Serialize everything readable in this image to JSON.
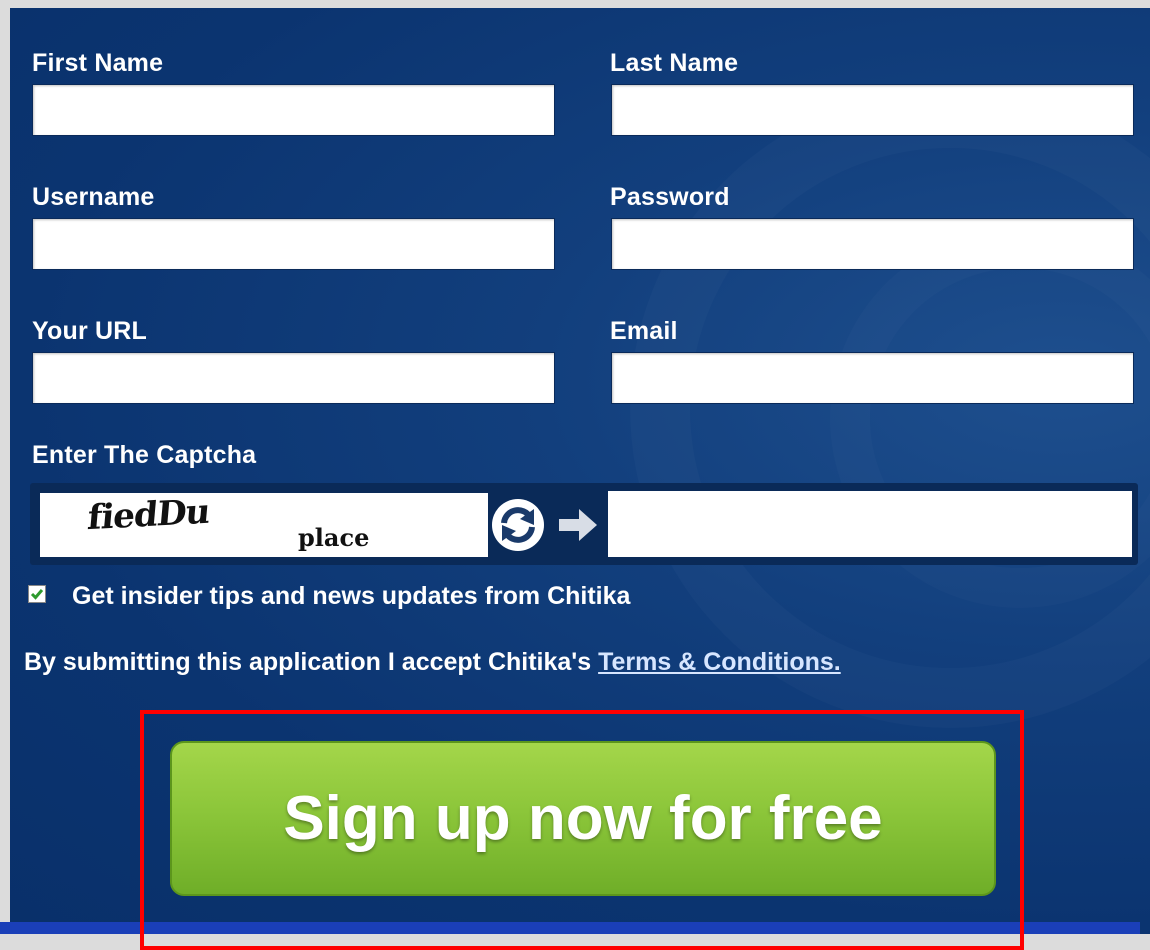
{
  "form": {
    "first_name_label": "First Name",
    "first_name_value": "",
    "last_name_label": "Last Name",
    "last_name_value": "",
    "username_label": "Username",
    "username_value": "",
    "password_label": "Password",
    "password_value": "",
    "url_label": "Your URL",
    "url_value": "",
    "email_label": "Email",
    "email_value": ""
  },
  "captcha": {
    "label": "Enter The Captcha",
    "word1": "fiedDu",
    "word2": "place",
    "input_value": "",
    "refresh_icon": "refresh-icon",
    "arrow_icon": "arrow-right-icon"
  },
  "newsletter": {
    "checked": true,
    "label": "Get insider tips and news updates from Chitika"
  },
  "terms": {
    "text": "By submitting this application I accept Chitika's ",
    "link": "Terms & Conditions."
  },
  "signup": {
    "label": "Sign up now for free"
  },
  "colors": {
    "panel_bg": "#0b3470",
    "button_green": "#8cc63a",
    "highlight_red": "#ff0000"
  }
}
